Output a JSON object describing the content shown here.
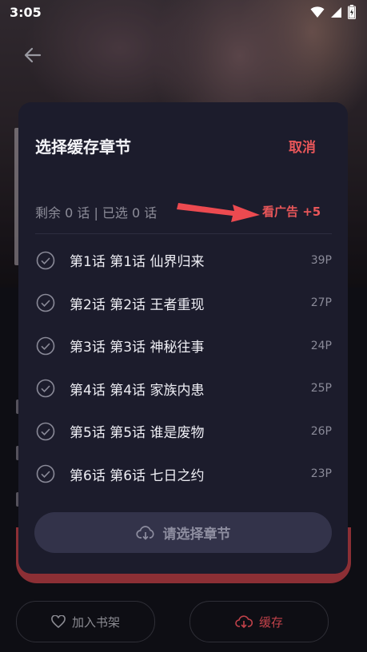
{
  "status_bar": {
    "time": "3:05",
    "icons": [
      "wifi-icon",
      "signal-icon",
      "battery-icon"
    ]
  },
  "sheet": {
    "title": "选择缓存章节",
    "cancel_label": "取消",
    "summary": "剩余 0 话 | 已选 0 话",
    "watch_ad_label": "看广告 +5",
    "chapters": [
      {
        "title": "第1话 第1话 仙界归来",
        "pages": "39P"
      },
      {
        "title": "第2话 第2话 王者重现",
        "pages": "27P"
      },
      {
        "title": "第3话 第3话 神秘往事",
        "pages": "24P"
      },
      {
        "title": "第4话 第4话 家族内患",
        "pages": "25P"
      },
      {
        "title": "第5话 第5话 谁是废物",
        "pages": "26P"
      },
      {
        "title": "第6话 第6话 七日之约",
        "pages": "23P"
      }
    ],
    "confirm_label": "请选择章节"
  },
  "bottom_bar": {
    "shelf_label": "加入书架",
    "cache_label": "缓存"
  },
  "colors": {
    "accent": "#e85659",
    "sheet_bg": "#1c1c2c",
    "button_bg": "#33334a"
  }
}
